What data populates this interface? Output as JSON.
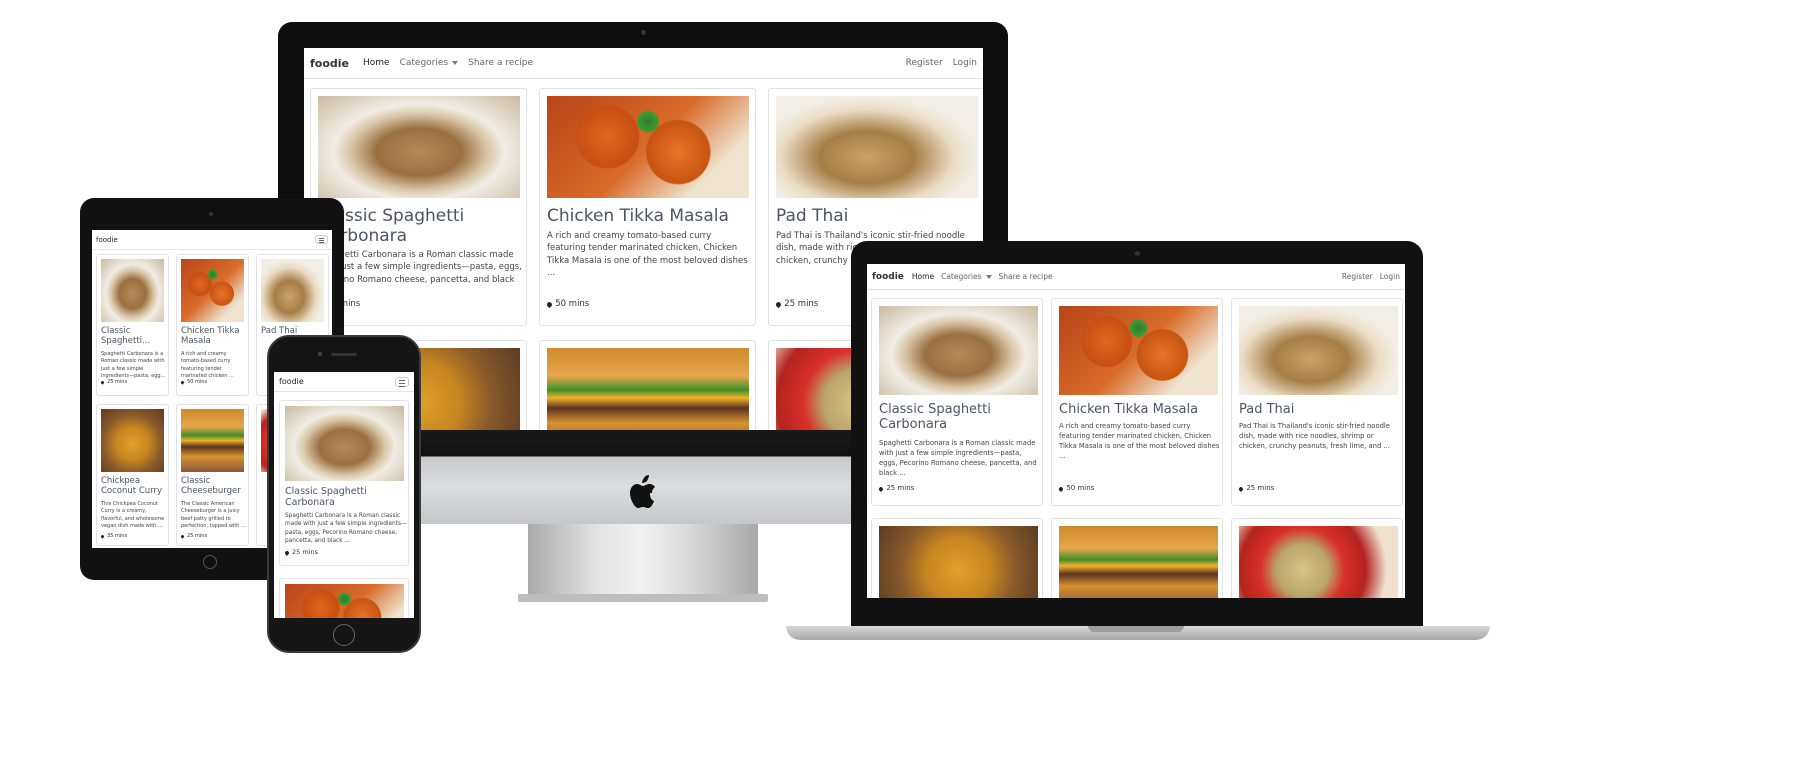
{
  "site": {
    "brand": "foodie",
    "nav": {
      "home": "Home",
      "categories": "Categories",
      "share": "Share a recipe",
      "register": "Register",
      "login": "Login"
    }
  },
  "recipes": [
    {
      "title": "Classic Spaghetti Carbonara",
      "title_trunc": "Classic Spaghetti...",
      "desc": "Spaghetti Carbonara is a Roman classic made with just a few simple ingredients—pasta, eggs, Pecorino Romano cheese, pancetta, and black ...",
      "desc_short": "Spaghetti Carbonara is a Roman classic made with just a few simple ingredients—pasta, eggs, ...",
      "desc_tiny": "Spaghetti Carbonara is a Roman classic made with just a few simple ingredients—pasta, egg...",
      "time": "25 mins"
    },
    {
      "title": "Chicken Tikka Masala",
      "desc": "A rich and creamy tomato-based curry featuring tender marinated chicken, Chicken Tikka Masala is one of the most beloved dishes ...",
      "desc_tiny": "A rich and creamy tomato-based curry featuring tender marinated chicken ...",
      "time": "50 mins"
    },
    {
      "title": "Pad Thai",
      "desc": "Pad Thai is Thailand's iconic stir-fried noodle dish, made with rice noodles, shrimp or chicken, crunchy peanuts, fresh lime, and ...",
      "time": "25 mins"
    },
    {
      "title": "Chickpea Coconut Curry",
      "desc_tiny": "This Chickpea Coconut Curry is a creamy, flavorful, and wholesome vegan dish made with ...",
      "time": "35 mins"
    },
    {
      "title": "Classic Cheeseburger",
      "desc_tiny": "The Classic American Cheeseburger is a juicy beef patty grilled to perfection, topped with ...",
      "time": "25 mins"
    }
  ]
}
